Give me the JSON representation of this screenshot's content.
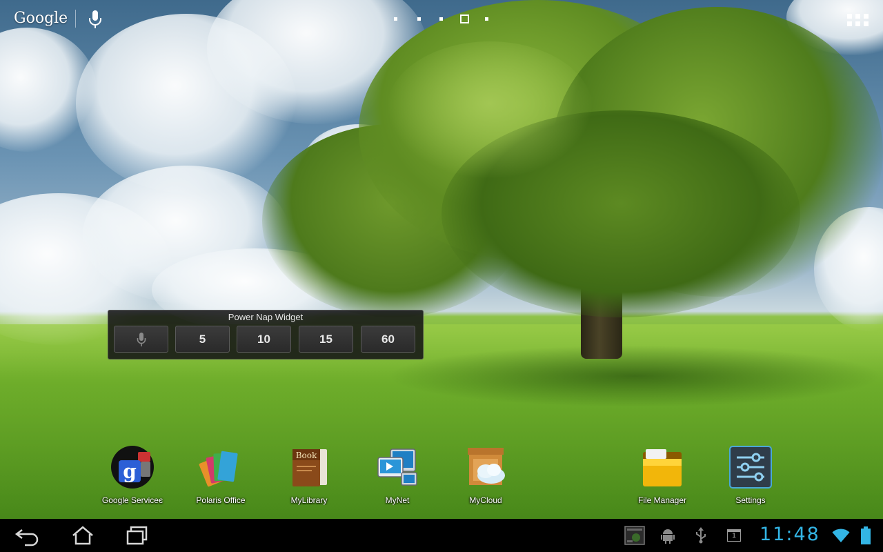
{
  "search": {
    "brand": "Google"
  },
  "widget": {
    "title": "Power Nap Widget",
    "buttons": [
      {
        "label": ""
      },
      {
        "label": "5"
      },
      {
        "label": "10"
      },
      {
        "label": "15"
      },
      {
        "label": "60"
      }
    ]
  },
  "home_screen": {
    "page_count": 5,
    "current_page": 4
  },
  "dock": {
    "apps": [
      {
        "label": "Google Serviceє",
        "icon": "google-services-icon"
      },
      {
        "label": "Polaris Office",
        "icon": "polaris-office-icon"
      },
      {
        "label": "MyLibrary",
        "icon": "mylibrary-icon"
      },
      {
        "label": "MyNet",
        "icon": "mynet-icon"
      },
      {
        "label": "MyCloud",
        "icon": "mycloud-icon"
      },
      {
        "label": "File Manager",
        "icon": "file-manager-icon"
      },
      {
        "label": "Settings",
        "icon": "settings-icon"
      }
    ]
  },
  "status_bar": {
    "time": "11:48",
    "notification_count": "1",
    "accent_color": "#33b5e5"
  }
}
